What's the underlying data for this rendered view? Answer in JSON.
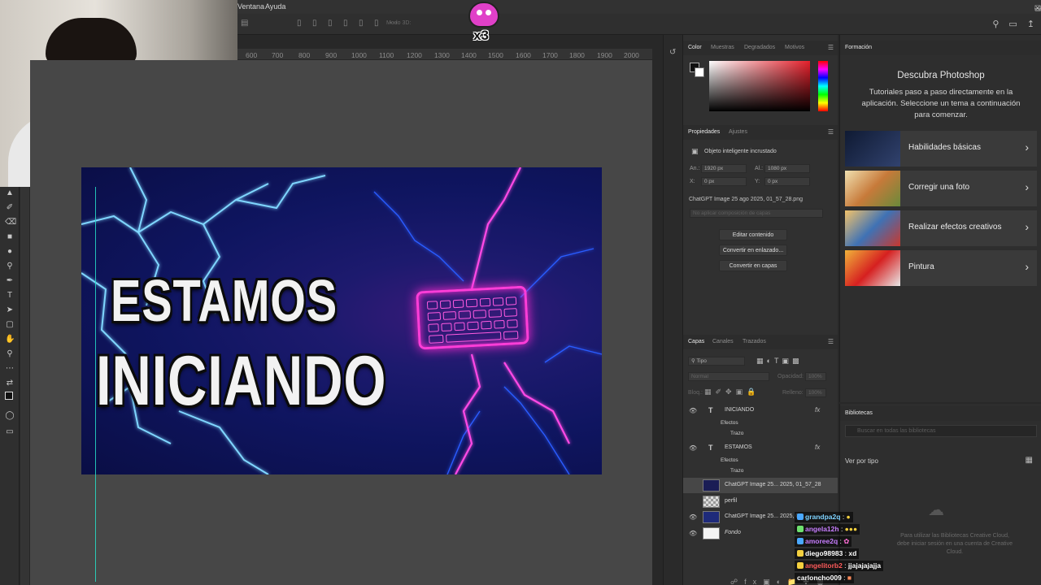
{
  "menu": {
    "items": [
      "Ventana",
      "Ayuda"
    ]
  },
  "options_bar": {
    "mode_label": "Modo 3D:"
  },
  "overlay": {
    "multiplier": "x3"
  },
  "ruler": {
    "ticks": [
      "600",
      "700",
      "800",
      "900",
      "1000",
      "1100",
      "1200",
      "1300",
      "1400",
      "1500",
      "1600",
      "1700",
      "1800",
      "1900",
      "2000"
    ]
  },
  "artwork": {
    "line1": "ESTAMOS",
    "line2": "INICIANDO"
  },
  "color_panel": {
    "tabs": [
      "Color",
      "Muestras",
      "Degradados",
      "Motivos"
    ],
    "accent": "#e5202b"
  },
  "properties": {
    "tabs": [
      "Propiedades",
      "Ajustes"
    ],
    "object_type": "Objeto inteligente incrustado",
    "w_label": "An.:",
    "w_value": "1920 px",
    "h_label": "Al.:",
    "h_value": "1080 px",
    "x_label": "X:",
    "x_value": "0 px",
    "y_label": "Y:",
    "y_value": "0 px",
    "filename": "ChatGPT Image 25 ago 2025, 01_57_28.png",
    "comp_placeholder": "No aplicar composición de capas",
    "buttons": [
      "Editar contenido",
      "Convertir en enlazado...",
      "Convertir en capas"
    ]
  },
  "layers_panel": {
    "tabs": [
      "Capas",
      "Canales",
      "Trazados"
    ],
    "filter": "Tipo",
    "blend": "Normal",
    "opacity_label": "Opacidad:",
    "opacity_value": "100%",
    "lock_label": "Bloq.:",
    "fill_label": "Relleno:",
    "fill_value": "100%",
    "layers": [
      {
        "name": "INICIANDO",
        "kind": "text",
        "fx": "fx",
        "sub1": "Efectos",
        "sub2": "Trazo"
      },
      {
        "name": "ESTAMOS",
        "kind": "text",
        "fx": "fx",
        "sub1": "Efectos",
        "sub2": "Trazo"
      },
      {
        "name": "ChatGPT Image 25... 2025, 01_57_28",
        "kind": "smart"
      },
      {
        "name": "perfil",
        "kind": "raster"
      },
      {
        "name": "ChatGPT Image 25... 2025, 01...",
        "kind": "smart"
      },
      {
        "name": "Fondo",
        "kind": "background"
      }
    ]
  },
  "learn": {
    "tab": "Formación",
    "title": "Descubra Photoshop",
    "description": "Tutoriales paso a paso directamente en la aplicación. Seleccione un tema a continuación para comenzar.",
    "cards": [
      {
        "label": "Habilidades básicas",
        "color": "#1f2a4a"
      },
      {
        "label": "Corregir una foto",
        "color": "#d7a45a"
      },
      {
        "label": "Realizar efectos creativos",
        "color": "#3a6aa8"
      },
      {
        "label": "Pintura",
        "color": "#d62020"
      }
    ]
  },
  "libraries": {
    "tab": "Bibliotecas",
    "search_placeholder": "Buscar en todas las bibliotecas",
    "view_by": "Ver por tipo",
    "note": "Para utilizar las Bibliotecas Creative Cloud, debe iniciar sesión en una cuenta de Creative Cloud."
  },
  "chat": [
    {
      "user": "grandpa2q",
      "text": "",
      "color": "#7fd3ff"
    },
    {
      "user": "angela12h",
      "text": "",
      "color": "#c77dff"
    },
    {
      "user": "amoree2q",
      "text": "",
      "color": "#c77dff"
    },
    {
      "user": "diego98983",
      "text": "xd",
      "color": "#ffffff"
    },
    {
      "user": "angelitorb2",
      "text": "jjajajajajja",
      "color": "#ff5a5a"
    },
    {
      "user": "carloncho009",
      "text": "",
      "color": "#ffffff"
    }
  ]
}
